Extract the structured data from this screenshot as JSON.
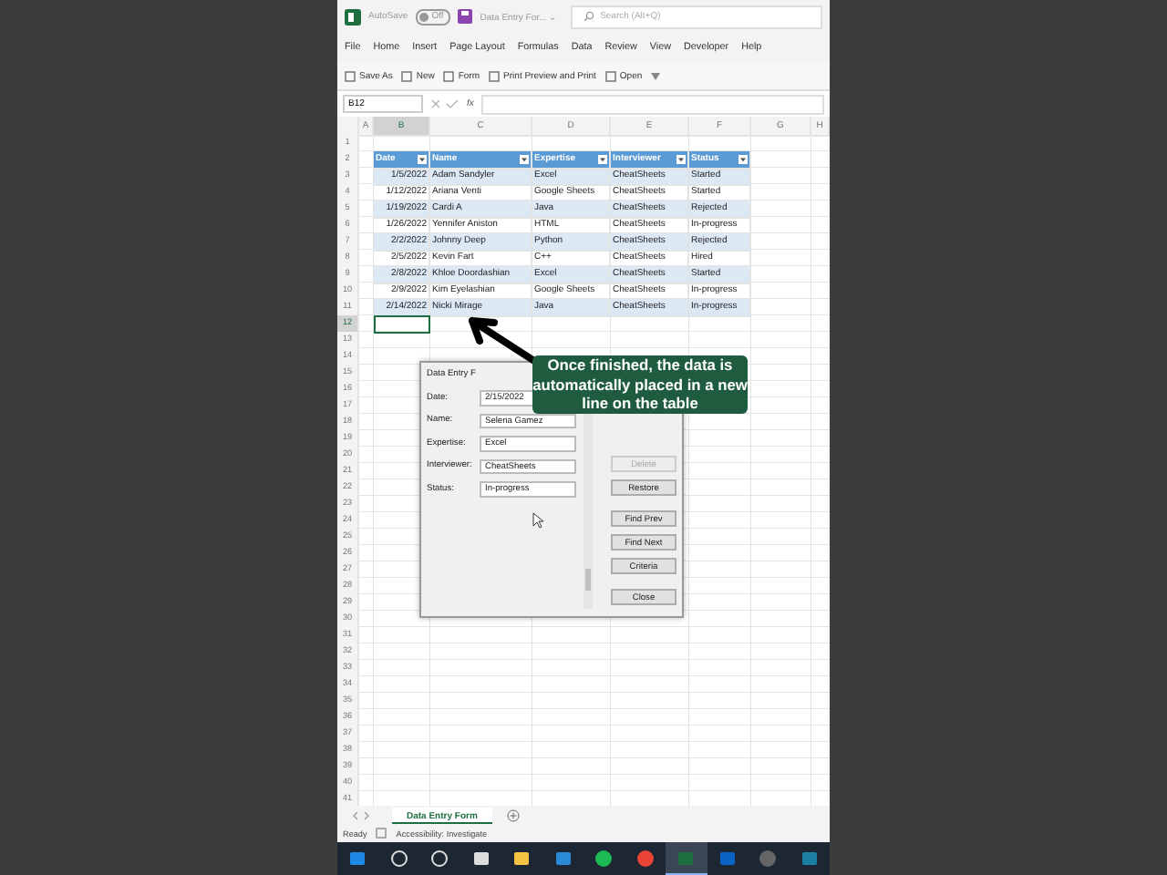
{
  "titlebar": {
    "autosave_label": "AutoSave",
    "autosave_on": false,
    "toggle_text": "Off",
    "file_name": "Data Entry For... ⌄",
    "search_placeholder": "Search (Alt+Q)"
  },
  "menu": [
    "File",
    "Home",
    "Insert",
    "Page Layout",
    "Formulas",
    "Data",
    "Review",
    "View",
    "Developer",
    "Help"
  ],
  "quick_toolbar": [
    "Save As",
    "New",
    "Form",
    "Print Preview and Print",
    "Open"
  ],
  "formula_bar": {
    "name_box": "B12",
    "fx": "fx"
  },
  "columns": [
    "A",
    "B",
    "C",
    "D",
    "E",
    "F",
    "G",
    "H"
  ],
  "row_numbers": [
    "1",
    "2",
    "3",
    "4",
    "5",
    "6",
    "7",
    "8",
    "9",
    "10",
    "11",
    "12",
    "13",
    "14",
    "15",
    "16",
    "17",
    "18",
    "19",
    "20",
    "21",
    "22",
    "23",
    "24",
    "25",
    "26",
    "27",
    "28",
    "29",
    "30",
    "31",
    "32",
    "33",
    "34",
    "35",
    "36",
    "37",
    "38",
    "39",
    "40",
    "41"
  ],
  "table": {
    "columns": [
      "Date",
      "Name",
      "Expertise",
      "Interviewer",
      "Status"
    ],
    "rows": [
      [
        "1/5/2022",
        "Adam Sandyler",
        "Excel",
        "CheatSheets",
        "Started"
      ],
      [
        "1/12/2022",
        "Ariana Venti",
        "Google Sheets",
        "CheatSheets",
        "Started"
      ],
      [
        "1/19/2022",
        "Cardi A",
        "Java",
        "CheatSheets",
        "Rejected"
      ],
      [
        "1/26/2022",
        "Yennifer Aniston",
        "HTML",
        "CheatSheets",
        "In-progress"
      ],
      [
        "2/2/2022",
        "Johnny Deep",
        "Python",
        "CheatSheets",
        "Rejected"
      ],
      [
        "2/5/2022",
        "Kevin Fart",
        "C++",
        "CheatSheets",
        "Hired"
      ],
      [
        "2/8/2022",
        "Khloe Doordashian",
        "Excel",
        "CheatSheets",
        "Started"
      ],
      [
        "2/9/2022",
        "Kim Eyelashian",
        "Google Sheets",
        "CheatSheets",
        "In-progress"
      ],
      [
        "2/14/2022",
        "Nicki Mirage",
        "Java",
        "CheatSheets",
        "In-progress"
      ]
    ]
  },
  "dialog": {
    "title": "Data Entry F",
    "fields": [
      {
        "label": "Date:",
        "value": "2/15/2022"
      },
      {
        "label": "Name:",
        "value": "Selena Gamez"
      },
      {
        "label": "Expertise:",
        "value": "Excel"
      },
      {
        "label": "Interviewer:",
        "value": "CheatSheets"
      },
      {
        "label": "Status:",
        "value": "In-progress"
      }
    ],
    "buttons": [
      {
        "label": "Delete",
        "disabled": true
      },
      {
        "label": "Restore",
        "disabled": false
      },
      {
        "label": "Find Prev",
        "disabled": false
      },
      {
        "label": "Find Next",
        "disabled": false
      },
      {
        "label": "Criteria",
        "disabled": false
      },
      {
        "label": "Close",
        "disabled": false
      }
    ]
  },
  "annotation": {
    "text": "Once finished, the data is automatically placed in a new line on the table"
  },
  "sheet_tabs": [
    {
      "label": "Data Entry Form",
      "selected": true
    }
  ],
  "status_bar": {
    "ready": "Ready",
    "accessibility": "Accessibility: Investigate"
  },
  "taskbar": [
    {
      "selected": false
    },
    {
      "selected": false
    },
    {
      "selected": false
    },
    {
      "selected": false
    },
    {
      "selected": false
    },
    {
      "selected": false
    },
    {
      "selected": false
    },
    {
      "selected": false
    },
    {
      "selected": true
    },
    {
      "selected": false
    },
    {
      "selected": false
    },
    {
      "selected": false
    }
  ]
}
